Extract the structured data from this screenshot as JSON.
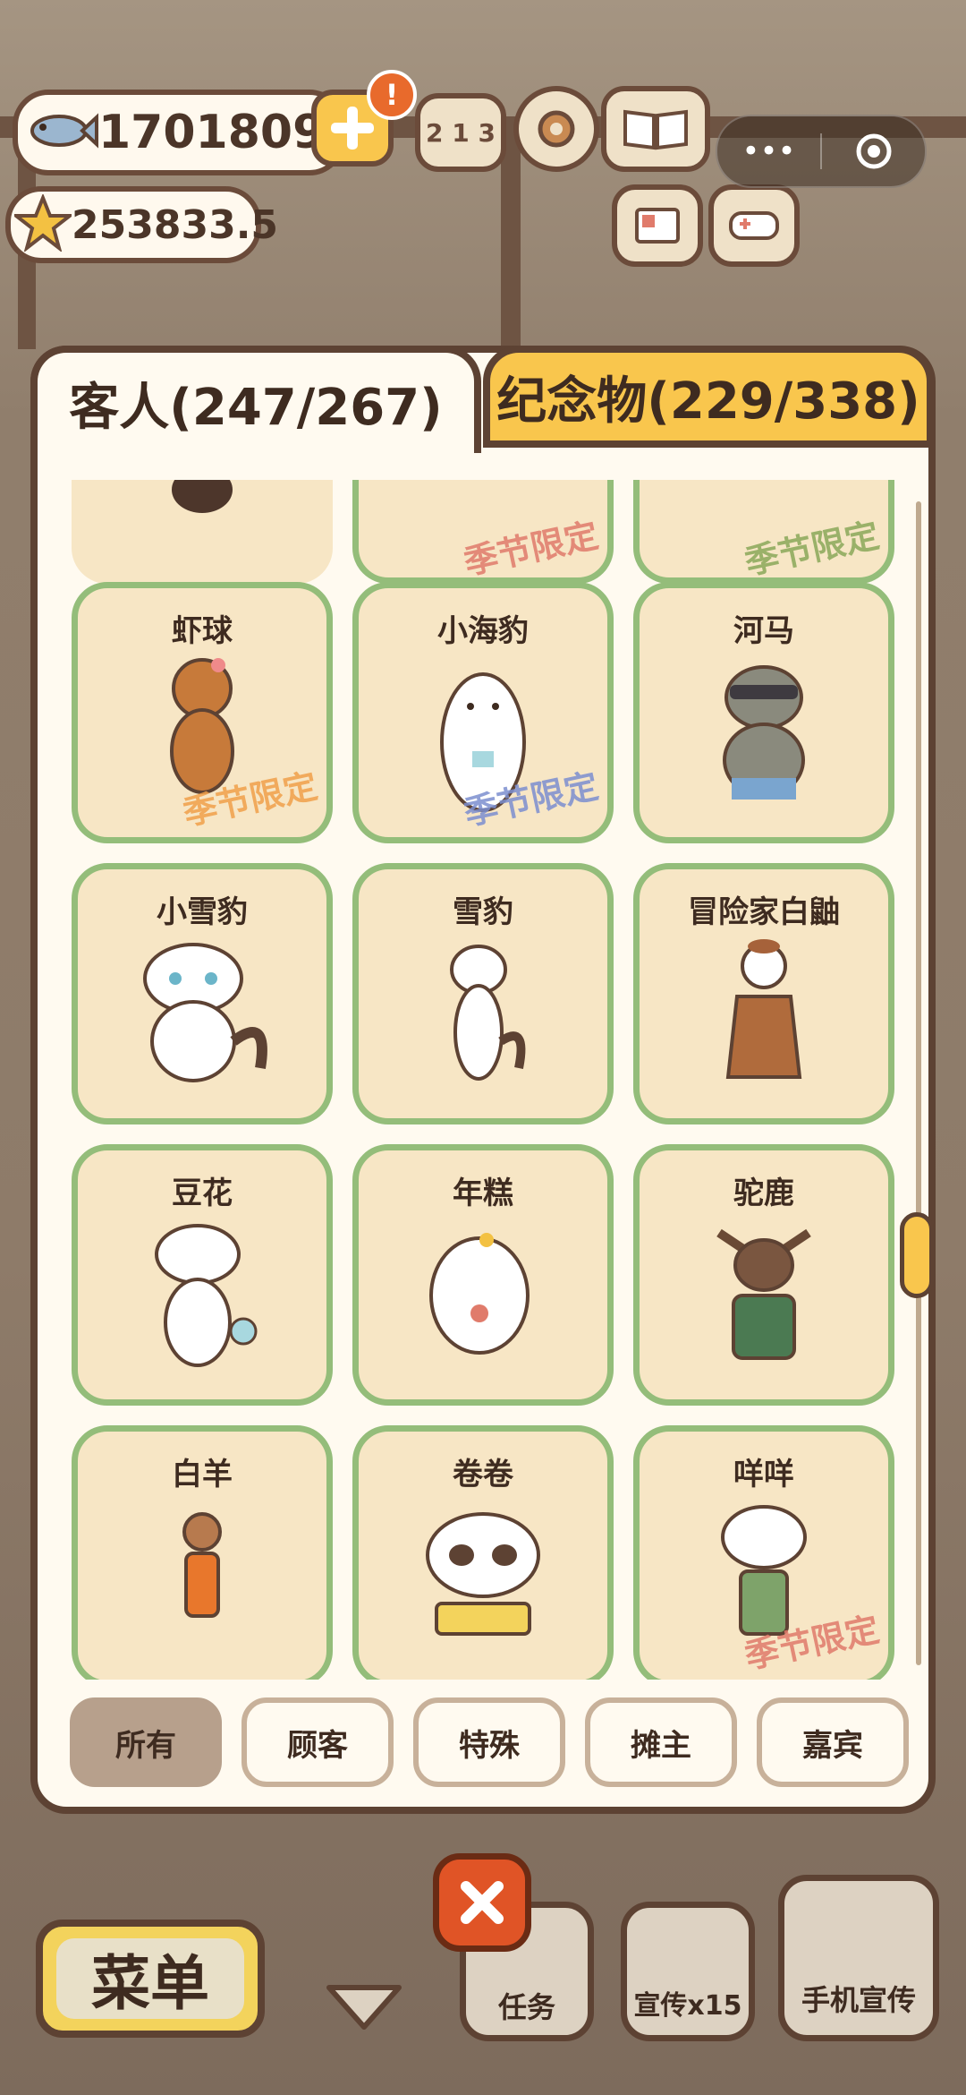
{
  "currency": {
    "fish": "1701809",
    "stars": "253833.5"
  },
  "tabs": [
    {
      "label": "客人(247/267)",
      "active": true
    },
    {
      "label": "纪念物(229/338)",
      "active": false
    }
  ],
  "season_tag": "季节限定",
  "partial_row": [
    {
      "season": false
    },
    {
      "season": true,
      "season_color": "#e07b6b"
    },
    {
      "season": true,
      "season_color": "#8aa85a"
    }
  ],
  "cards": [
    {
      "name": "虾球",
      "season": true,
      "season_color": "#f0a04a",
      "art": "poodle"
    },
    {
      "name": "小海豹",
      "season": true,
      "season_color": "#7c8fd0",
      "art": "seal"
    },
    {
      "name": "河马",
      "season": false,
      "art": "hippo"
    },
    {
      "name": "小雪豹",
      "season": false,
      "art": "snowleopard-cub"
    },
    {
      "name": "雪豹",
      "season": false,
      "art": "snowleopard"
    },
    {
      "name": "冒险家白鼬",
      "season": false,
      "art": "ermine"
    },
    {
      "name": "豆花",
      "season": false,
      "art": "dog"
    },
    {
      "name": "年糕",
      "season": false,
      "art": "pomeranian"
    },
    {
      "name": "驼鹿",
      "season": false,
      "art": "moose"
    },
    {
      "name": "白羊",
      "season": false,
      "art": "boy"
    },
    {
      "name": "卷卷",
      "season": false,
      "art": "panda"
    },
    {
      "name": "咩咩",
      "season": true,
      "season_color": "#e07b6b",
      "art": "sheep"
    }
  ],
  "filters": [
    {
      "label": "所有",
      "active": true
    },
    {
      "label": "顾客",
      "active": false
    },
    {
      "label": "特殊",
      "active": false
    },
    {
      "label": "摊主",
      "active": false
    },
    {
      "label": "嘉宾",
      "active": false
    }
  ],
  "bottom": {
    "menu": "菜单",
    "task": "任务",
    "promo": "宣传x15",
    "phone_promo": "手机宣传"
  },
  "colors": {
    "accent_yellow": "#f9c64d",
    "card_border": "#94bd7a",
    "card_bg": "#f7e6c5",
    "close_red": "#e05426"
  }
}
